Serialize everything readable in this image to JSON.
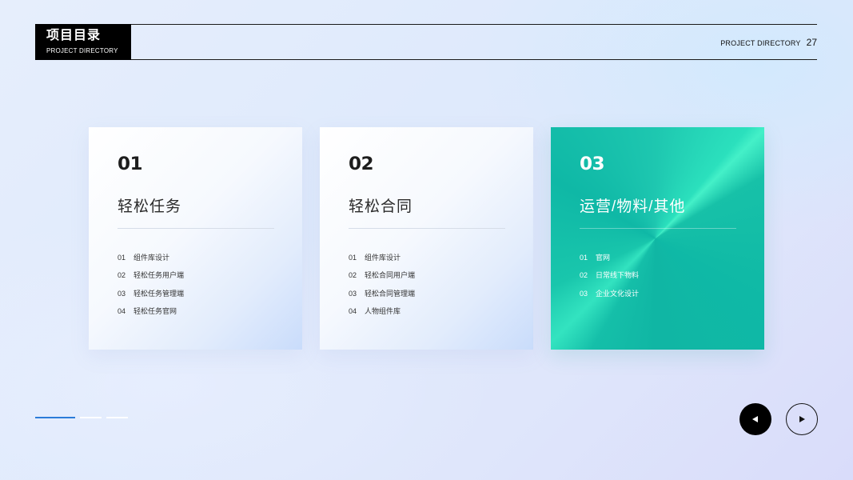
{
  "header": {
    "title_cn": "项目目录",
    "title_en": "PROJECT DIRECTORY",
    "right_label": "PROJECT DIRECTORY",
    "page_number": "27"
  },
  "cards": [
    {
      "number": "01",
      "title": "轻松任务",
      "items": [
        {
          "index": "01",
          "label": "组件库设计"
        },
        {
          "index": "02",
          "label": "轻松任务用户端"
        },
        {
          "index": "03",
          "label": "轻松任务管理端"
        },
        {
          "index": "04",
          "label": "轻松任务官网"
        }
      ]
    },
    {
      "number": "02",
      "title": "轻松合同",
      "items": [
        {
          "index": "01",
          "label": "组件库设计"
        },
        {
          "index": "02",
          "label": "轻松合同用户端"
        },
        {
          "index": "03",
          "label": "轻松合同管理端"
        },
        {
          "index": "04",
          "label": "人物组件库"
        }
      ]
    },
    {
      "number": "03",
      "title": "运营/物料/其他",
      "items": [
        {
          "index": "01",
          "label": "官网"
        },
        {
          "index": "02",
          "label": "日常线下物料"
        },
        {
          "index": "03",
          "label": "企业文化设计"
        }
      ]
    }
  ],
  "progress": {
    "current": 1,
    "total": 3
  },
  "navigation": {
    "prev_icon": "triangle-left-icon",
    "next_icon": "triangle-right-icon"
  },
  "colors": {
    "accent": "#2b7cd8",
    "teal": "#17c1a8",
    "dark": "#000000"
  }
}
